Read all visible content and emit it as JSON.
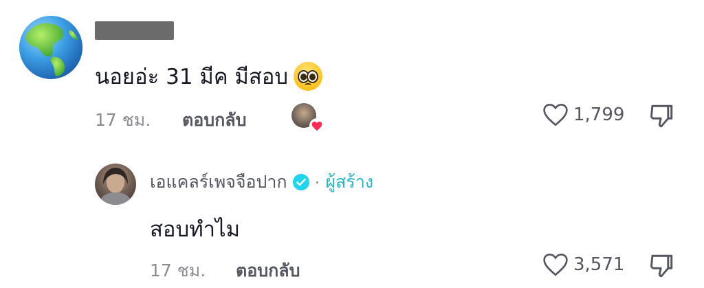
{
  "comment": {
    "author_avatar_icon": "globe-americas-icon",
    "text": "นอยอ่ะ 31 มีค มีสอบ",
    "emoji": "pleading-face-emoji",
    "time": "17 ชม.",
    "reply_label": "ตอบกลับ",
    "creator_liked": true,
    "like_count": "1,799"
  },
  "reply": {
    "author_name": "เอแคลร์เพจจือปาก",
    "verified": true,
    "separator": "·",
    "creator_badge": "ผู้สร้าง",
    "text": "สอบทำไม",
    "time": "17 ชม.",
    "reply_label": "ตอบกลับ",
    "like_count": "3,571"
  },
  "colors": {
    "text_primary": "#161823",
    "text_secondary": "#8a8b91",
    "verified": "#20d5ec",
    "creator_accent": "#25b6c9",
    "heart": "#fe2c55"
  }
}
